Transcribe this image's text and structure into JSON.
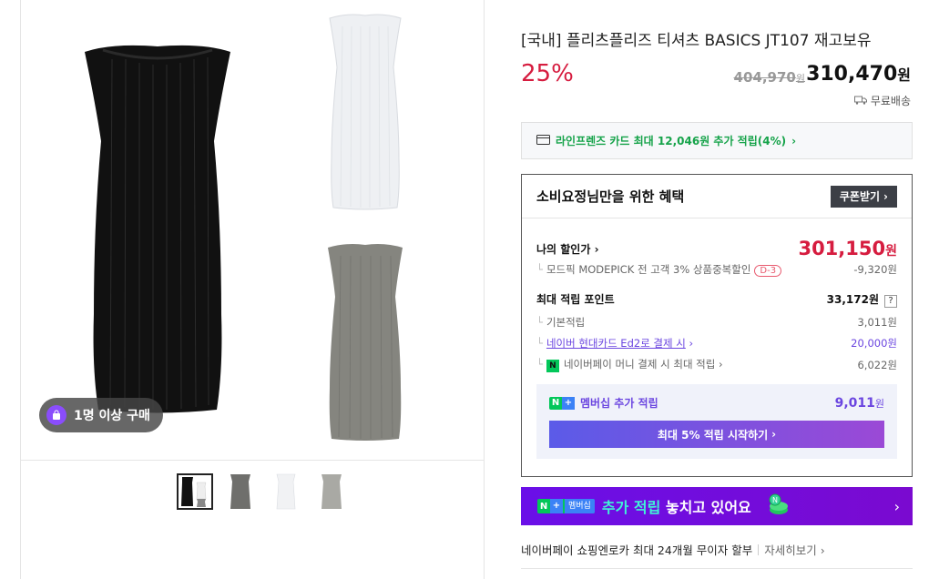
{
  "gallery": {
    "buy_badge": "1명 이상 구매",
    "thumbnails": [
      "black-white",
      "gray",
      "white",
      "light-gray"
    ]
  },
  "product": {
    "title": "[국내] 플리츠플리즈 티셔츠 BASICS JT107 재고보유",
    "discount": "25%",
    "original_price": "404,970",
    "original_unit": "원",
    "price": "310,470",
    "price_unit": "원",
    "delivery": "무료배송"
  },
  "card_promo": "라인프렌즈 카드 최대 12,046원 추가 적립(4%)",
  "benefit": {
    "heading": "소비요정님만을 위한 혜택",
    "coupon_button": "쿠폰받기",
    "my_discount_label": "나의 할인가",
    "my_discount_price": "301,150",
    "my_discount_unit": "원",
    "modepick_label": "모드픽 MODEPICK 전 고객 3% 상품중복할인",
    "modepick_badge": "D-3",
    "modepick_amount": "-9,320원",
    "max_point_label": "최대 적립 포인트",
    "max_point_value": "33,172원",
    "help_icon_text": "?",
    "basic_label": "기본적립",
    "basic_value": "3,011원",
    "card_label": "네이버 현대카드 Ed2로 결제 시",
    "card_value": "20,000원",
    "npay_label": "네이버페이 머니 결제 시 최대 적립",
    "npay_value": "6,022원",
    "member_label": "멤버십 추가 적립",
    "member_value": "9,011",
    "member_unit": "원",
    "start_button": "최대 5% 적립 시작하기"
  },
  "banner": {
    "tag": "멤버십",
    "highlight": "추가 적립",
    "rest": " 놓치고 있어요"
  },
  "promo": {
    "text": "네이버페이 쇼핑엔로카 최대 24개월 무이자 할부",
    "more": "자세히보기"
  },
  "colors": {
    "discount_red": "#d61c3f",
    "naver_green": "#03c75a",
    "membership_purple": "#6a0fe8"
  }
}
